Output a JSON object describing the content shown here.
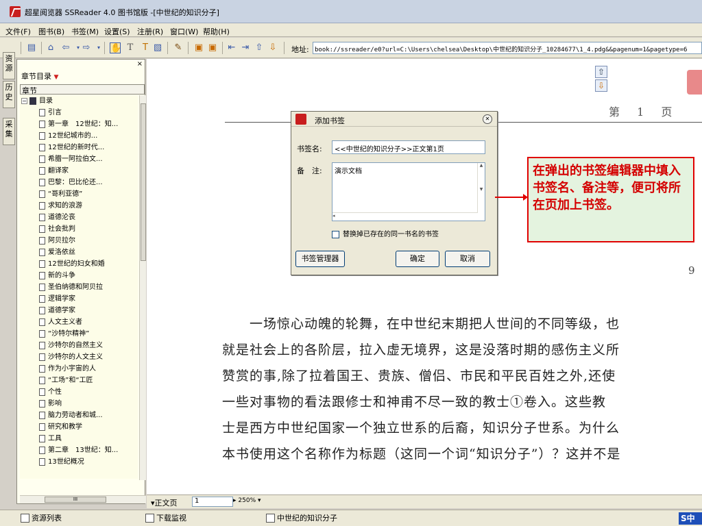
{
  "window": {
    "title": "超星阅览器 SSReader 4.0 图书馆版 -[中世纪的知识分子]"
  },
  "menubar": {
    "items": [
      "文件(F)",
      "图书(B)",
      "书签(M)",
      "设置(S)",
      "注册(R)",
      "窗口(W)",
      "帮助(H)"
    ]
  },
  "toolbar": {
    "address_label": "地址:",
    "address_value": "book://ssreader/e0?url=C:\\Users\\chelsea\\Desktop\\中世纪的知识分子_10284677\\1_4.pdg&&pagenum=1&pagetype=6",
    "icons": [
      "home-icon",
      "back-icon",
      "forward-icon",
      "hand-tool-icon",
      "text-select-icon",
      "text-recognize-icon",
      "area-select-icon",
      "marker-icon",
      "bookmark-add-icon",
      "bookmark-icon",
      "first-page-icon",
      "last-page-icon",
      "page-up-icon",
      "page-down-icon"
    ]
  },
  "vertical_tabs": [
    "资源",
    "历史",
    "采集"
  ],
  "sidepanel": {
    "dropdown_label": "章节目录",
    "column_header": "章节",
    "tree": [
      {
        "label": "目录",
        "level": 0,
        "type": "root"
      },
      {
        "label": "引言",
        "level": 1
      },
      {
        "label": "第一章　12世纪：知...",
        "level": 1
      },
      {
        "label": "12世纪城市的...",
        "level": 1
      },
      {
        "label": "12世纪的新时代...",
        "level": 1
      },
      {
        "label": "希腊一阿拉伯文...",
        "level": 1
      },
      {
        "label": "翻译家",
        "level": 1
      },
      {
        "label": "巴黎：巴比伦还...",
        "level": 1
      },
      {
        "label": "“哥利亚德”",
        "level": 1
      },
      {
        "label": "求知的浪游",
        "level": 1
      },
      {
        "label": "道德沦丧",
        "level": 1
      },
      {
        "label": "社会批判",
        "level": 1
      },
      {
        "label": "阿贝拉尔",
        "level": 1
      },
      {
        "label": "爱洛依丝",
        "level": 1
      },
      {
        "label": "12世纪的妇女和婚",
        "level": 1
      },
      {
        "label": "新的斗争",
        "level": 1
      },
      {
        "label": "圣伯纳德和阿贝拉",
        "level": 1
      },
      {
        "label": "逻辑学家",
        "level": 1
      },
      {
        "label": "道德学家",
        "level": 1
      },
      {
        "label": "人文主义者",
        "level": 1
      },
      {
        "label": "“沙特尔精神”",
        "level": 1
      },
      {
        "label": "沙特尔的自然主义",
        "level": 1
      },
      {
        "label": "沙特尔的人文主义",
        "level": 1
      },
      {
        "label": "作为小宇宙的人",
        "level": 1
      },
      {
        "label": "“工场”和“工匠",
        "level": 1
      },
      {
        "label": "个性",
        "level": 1
      },
      {
        "label": "影响",
        "level": 1
      },
      {
        "label": "脑力劳动者和城...",
        "level": 1
      },
      {
        "label": "研究和教学",
        "level": 1
      },
      {
        "label": "工具",
        "level": 1
      },
      {
        "label": "第二章　13世纪：知...",
        "level": 1
      },
      {
        "label": "13世纪概况",
        "level": 1
      }
    ]
  },
  "document": {
    "page_header": "第 1 页",
    "side_number": "9",
    "paragraph_lines": [
      "　　一场惊心动魄的轮舞，在中世纪末期把人世间的不同等级，也",
      "就是社会上的各阶层，拉入虚无境界，这是没落时期的感伤主义所",
      "赞赏的事,除了拉着国王、贵族、僧侣、市民和平民百姓之外,还使",
      "一些对事物的看法跟修士和神甫不尽一致的教士①卷入。这些教",
      "士是西方中世纪国家一个独立世系的后裔，知识分子世系。为什么",
      "本书使用这个名称作为标题（这同一个词“知识分子”）？这并不是"
    ]
  },
  "dialog": {
    "title": "添加书签",
    "name_label": "书签名:",
    "name_value": "<<中世纪的知识分子>>正文第1页",
    "note_label": "备　注:",
    "note_value": "演示文档",
    "checkbox_label": "替换掉已存在的同一书名的书签",
    "manager_button": "书签管理器",
    "ok_button": "确定",
    "cancel_button": "取消"
  },
  "callout": {
    "text": "在弹出的书签编辑器中填入书签名、备注等，便可将所在页加上书签。"
  },
  "bottombar": {
    "page_label": "▾正文页",
    "page_value": "1",
    "zoom": "250%"
  },
  "statusbar": {
    "items": [
      "资源列表",
      "下载监视",
      "中世纪的知识分子"
    ]
  },
  "colors": {
    "callout_border": "#e00000",
    "callout_bg": "#e4f3df",
    "app_red": "#c81e1e"
  }
}
